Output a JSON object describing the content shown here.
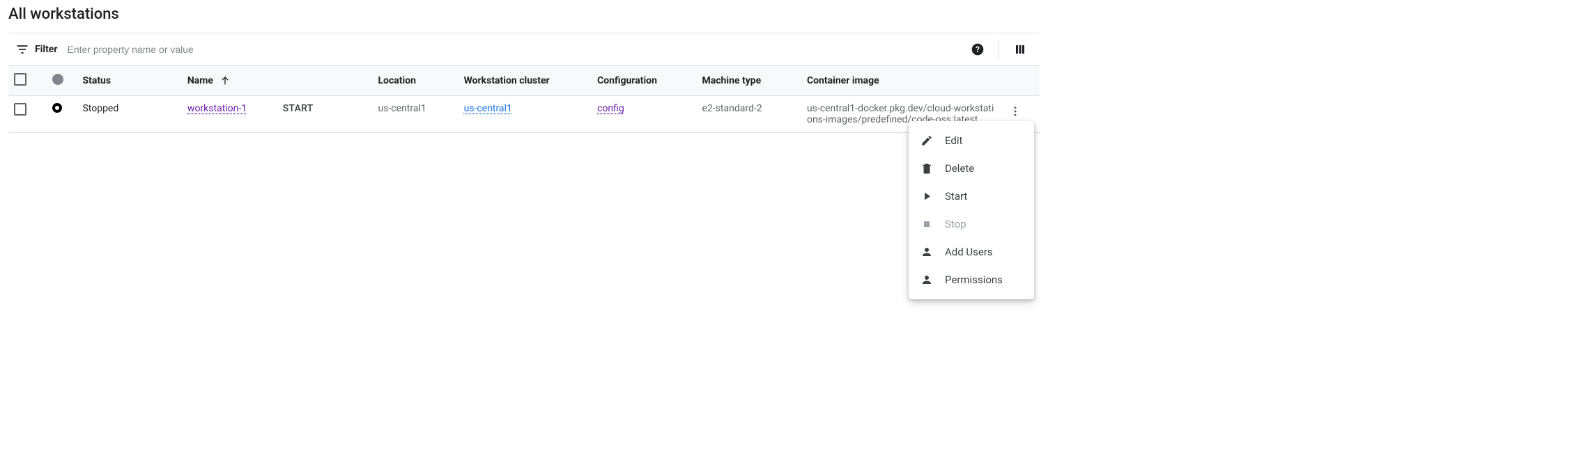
{
  "page": {
    "title": "All workstations"
  },
  "filter": {
    "label": "Filter",
    "placeholder": "Enter property name or value"
  },
  "table": {
    "headers": {
      "status": "Status",
      "name": "Name",
      "location": "Location",
      "cluster": "Workstation cluster",
      "config": "Configuration",
      "machine_type": "Machine type",
      "container_image": "Container image"
    },
    "rows": [
      {
        "status": "Stopped",
        "name": "workstation-1",
        "action": "START",
        "location": "us-central1",
        "cluster": "us-central1",
        "config": "config",
        "machine_type": "e2-standard-2",
        "container_image": "us-central1-docker.pkg.dev/cloud-workstations-images/predefined/code-oss:latest"
      }
    ]
  },
  "menu": {
    "edit": "Edit",
    "delete": "Delete",
    "start": "Start",
    "stop": "Stop",
    "add_users": "Add Users",
    "permissions": "Permissions"
  }
}
